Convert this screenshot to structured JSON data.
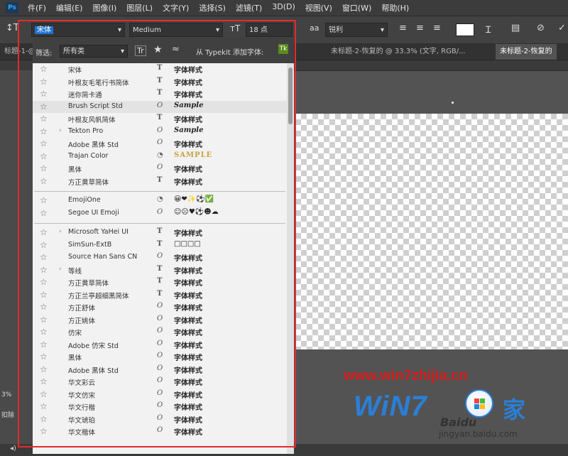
{
  "menubar": {
    "items": [
      "件(F)",
      "编辑(E)",
      "图像(I)",
      "图层(L)",
      "文字(Y)",
      "选择(S)",
      "滤镜(T)",
      "3D(D)",
      "视图(V)",
      "窗口(W)",
      "帮助(H)"
    ]
  },
  "options_bar": {
    "font_family_value": "宋体",
    "font_style_value": "Medium",
    "font_size_value": "18 点",
    "antialias_value": "锐利"
  },
  "tabs": [
    {
      "label": "标题-1-@",
      "active": false
    },
    {
      "label": "未标题-2-恢复的 @ 33.3% (文字, RGB/...",
      "active": false
    },
    {
      "label": "未标题-2-恢复的",
      "active": true
    }
  ],
  "font_panel": {
    "filter_label": "筛选:",
    "filter_value": "所有类",
    "typekit_label": "从 Typekit 添加字体:",
    "groups": [
      [
        {
          "name": "宋体",
          "type": "T",
          "sample": "字体样式",
          "expand": false
        },
        {
          "name": "叶根友毛笔行书简体",
          "type": "T",
          "sample": "字体样式",
          "expand": false
        },
        {
          "name": "迷你简卡通",
          "type": "T",
          "sample": "字体样式",
          "expand": false
        },
        {
          "name": "Brush Script Std",
          "type": "O",
          "sample": "Sample",
          "expand": false,
          "highlight": true
        },
        {
          "name": "叶根友风帆简体",
          "type": "T",
          "sample": "字体样式",
          "expand": false
        },
        {
          "name": "Tekton Pro",
          "type": "O",
          "sample": "Sample",
          "expand": true
        },
        {
          "name": "Adobe 黑体 Std",
          "type": "O",
          "sample": "字体样式",
          "expand": false
        },
        {
          "name": "Trajan Color",
          "type": "Color",
          "sample": "SAMPLE",
          "expand": false
        },
        {
          "name": "黑体",
          "type": "O",
          "sample": "字体样式",
          "expand": false
        },
        {
          "name": "方正黄草简体",
          "type": "T",
          "sample": "字体样式",
          "expand": false
        }
      ],
      [
        {
          "name": "EmojiOne",
          "type": "Color",
          "sample": "😀❤✨⚽✅",
          "expand": false
        },
        {
          "name": "Segoe UI Emoji",
          "type": "O",
          "sample": "☺☹♥⚽☻☁",
          "expand": false
        }
      ],
      [
        {
          "name": "Microsoft YaHei UI",
          "type": "T",
          "sample": "字体样式",
          "expand": true
        },
        {
          "name": "SimSun-ExtB",
          "type": "T",
          "sample": "□□□□",
          "expand": false
        },
        {
          "name": "Source Han Sans CN",
          "type": "O",
          "sample": "字体样式",
          "expand": false
        },
        {
          "name": "等线",
          "type": "T",
          "sample": "字体样式",
          "expand": true
        },
        {
          "name": "方正黄草简体",
          "type": "T",
          "sample": "字体样式",
          "expand": false
        },
        {
          "name": "方正兰亭超细黑简体",
          "type": "T",
          "sample": "字体样式",
          "expand": false
        },
        {
          "name": "方正舒体",
          "type": "O",
          "sample": "字体样式",
          "expand": false
        },
        {
          "name": "方正姚体",
          "type": "O",
          "sample": "字体样式",
          "expand": false
        },
        {
          "name": "仿宋",
          "type": "O",
          "sample": "字体样式",
          "expand": false
        },
        {
          "name": "Adobe 仿宋 Std",
          "type": "O",
          "sample": "字体样式",
          "expand": false
        },
        {
          "name": "黑体",
          "type": "O",
          "sample": "字体样式",
          "expand": false
        },
        {
          "name": "Adobe 黑体 Std",
          "type": "O",
          "sample": "字体样式",
          "expand": false
        },
        {
          "name": "华文彩云",
          "type": "O",
          "sample": "字体样式",
          "expand": false
        },
        {
          "name": "华文仿宋",
          "type": "O",
          "sample": "字体样式",
          "expand": false
        },
        {
          "name": "华文行楷",
          "type": "O",
          "sample": "字体样式",
          "expand": false
        },
        {
          "name": "华文琥珀",
          "type": "O",
          "sample": "字体样式",
          "expand": false
        },
        {
          "name": "华文楷体",
          "type": "O",
          "sample": "字体样式",
          "expand": false
        }
      ]
    ]
  },
  "left_info": {
    "zoom": "3%",
    "label": "扣除"
  },
  "watermark": {
    "url": "www.win7zhijia.cn",
    "logo": "WiN7",
    "jia": "家",
    "baidu": "Baidu",
    "jingyan": "jingyan.baidu.com"
  },
  "colors": {
    "highlight_box": "#e52b2b",
    "selection": "#1e73d2"
  }
}
